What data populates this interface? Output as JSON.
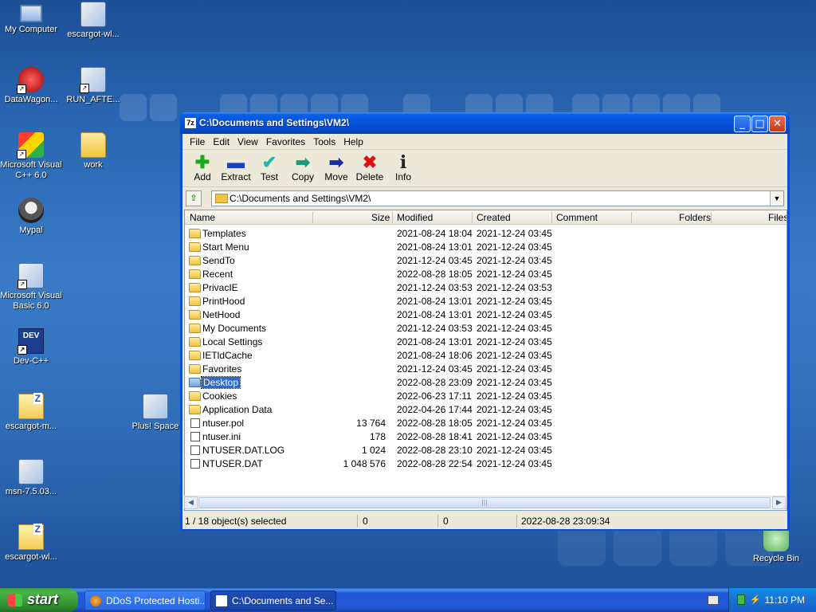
{
  "desktop": {
    "icons": [
      {
        "label": "My Computer"
      },
      {
        "label": "escargot-wl..."
      },
      {
        "label": "DataWagon..."
      },
      {
        "label": "RUN_AFTE..."
      },
      {
        "label": "Microsoft Visual C++ 6.0"
      },
      {
        "label": "work"
      },
      {
        "label": "Mypal"
      },
      {
        "label": "Microsoft Visual Basic 6.0"
      },
      {
        "label": "Dev-C++",
        "glyph": "DEV"
      },
      {
        "label": "escargot-m..."
      },
      {
        "label": "Plus! Space"
      },
      {
        "label": "msn-7.5.03..."
      },
      {
        "label": "escargot-wl..."
      },
      {
        "label": "Recycle Bin"
      }
    ]
  },
  "window": {
    "app_icon": "7z",
    "title": "C:\\Documents and Settings\\VM2\\",
    "controls": {
      "minimize": "_",
      "maximize": "□",
      "close": "✕"
    },
    "menu": [
      "File",
      "Edit",
      "View",
      "Favorites",
      "Tools",
      "Help"
    ],
    "toolbar": [
      {
        "label": "Add",
        "icon": "plus-icon",
        "glyph": "✚",
        "color": "#1aa81a"
      },
      {
        "label": "Extract",
        "icon": "minus-icon",
        "glyph": "▬",
        "color": "#1a3fc2"
      },
      {
        "label": "Test",
        "icon": "check-icon",
        "glyph": "✔",
        "color": "#1fb7b0"
      },
      {
        "label": "Copy",
        "icon": "copy-arrow-icon",
        "glyph": "➡",
        "color": "#1a9e7a"
      },
      {
        "label": "Move",
        "icon": "move-arrow-icon",
        "glyph": "➡",
        "color": "#1a2d9e"
      },
      {
        "label": "Delete",
        "icon": "delete-x-icon",
        "glyph": "✖",
        "color": "#e01010"
      },
      {
        "label": "Info",
        "icon": "info-icon",
        "glyph": "i",
        "color": "#222222"
      }
    ],
    "address": {
      "up_glyph": "⇧",
      "path": "C:\\Documents and Settings\\VM2\\",
      "dropdown_glyph": "▼"
    },
    "columns": [
      "Name",
      "Size",
      "Modified",
      "Created",
      "Comment",
      "Folders",
      "Files"
    ],
    "rows": [
      {
        "name": "Templates",
        "type": "folder",
        "size": "",
        "modified": "2021-08-24 18:04",
        "created": "2021-12-24 03:45"
      },
      {
        "name": "Start Menu",
        "type": "folder",
        "size": "",
        "modified": "2021-08-24 13:01",
        "created": "2021-12-24 03:45"
      },
      {
        "name": "SendTo",
        "type": "folder",
        "size": "",
        "modified": "2021-12-24 03:45",
        "created": "2021-12-24 03:45"
      },
      {
        "name": "Recent",
        "type": "folder",
        "size": "",
        "modified": "2022-08-28 18:05",
        "created": "2021-12-24 03:45"
      },
      {
        "name": "PrivacIE",
        "type": "folder",
        "size": "",
        "modified": "2021-12-24 03:53",
        "created": "2021-12-24 03:53"
      },
      {
        "name": "PrintHood",
        "type": "folder",
        "size": "",
        "modified": "2021-08-24 13:01",
        "created": "2021-12-24 03:45"
      },
      {
        "name": "NetHood",
        "type": "folder",
        "size": "",
        "modified": "2021-08-24 13:01",
        "created": "2021-12-24 03:45"
      },
      {
        "name": "My Documents",
        "type": "folder",
        "size": "",
        "modified": "2021-12-24 03:53",
        "created": "2021-12-24 03:45"
      },
      {
        "name": "Local Settings",
        "type": "folder",
        "size": "",
        "modified": "2021-08-24 13:01",
        "created": "2021-12-24 03:45"
      },
      {
        "name": "IETldCache",
        "type": "folder",
        "size": "",
        "modified": "2021-08-24 18:06",
        "created": "2021-12-24 03:45"
      },
      {
        "name": "Favorites",
        "type": "folder",
        "size": "",
        "modified": "2021-12-24 03:45",
        "created": "2021-12-24 03:45"
      },
      {
        "name": "Desktop",
        "type": "folder",
        "size": "",
        "modified": "2022-08-28 23:09",
        "created": "2021-12-24 03:45",
        "selected": true
      },
      {
        "name": "Cookies",
        "type": "folder",
        "size": "",
        "modified": "2022-06-23 17:11",
        "created": "2021-12-24 03:45"
      },
      {
        "name": "Application Data",
        "type": "folder",
        "size": "",
        "modified": "2022-04-26 17:44",
        "created": "2021-12-24 03:45"
      },
      {
        "name": "ntuser.pol",
        "type": "file",
        "size": "13 764",
        "modified": "2022-08-28 18:05",
        "created": "2021-12-24 03:45"
      },
      {
        "name": "ntuser.ini",
        "type": "file",
        "size": "178",
        "modified": "2022-08-28 18:41",
        "created": "2021-12-24 03:45"
      },
      {
        "name": "NTUSER.DAT.LOG",
        "type": "file",
        "size": "1 024",
        "modified": "2022-08-28 23:10",
        "created": "2021-12-24 03:45"
      },
      {
        "name": "NTUSER.DAT",
        "type": "file",
        "size": "1 048 576",
        "modified": "2022-08-28 22:54",
        "created": "2021-12-24 03:45"
      }
    ],
    "scrollbar": {
      "left": "◀",
      "right": "▶",
      "grip": "|||"
    },
    "status": {
      "selection": "1 / 18 object(s) selected",
      "size": "0",
      "packed": "0",
      "modified": "2022-08-28 23:09:34"
    }
  },
  "taskbar": {
    "start_label": "start",
    "items": [
      {
        "label": "DDoS Protected Hosti...",
        "active": false
      },
      {
        "label": "C:\\Documents and Se...",
        "active": true
      }
    ],
    "tray_glyph": "⚡",
    "clock": "11:10 PM"
  }
}
